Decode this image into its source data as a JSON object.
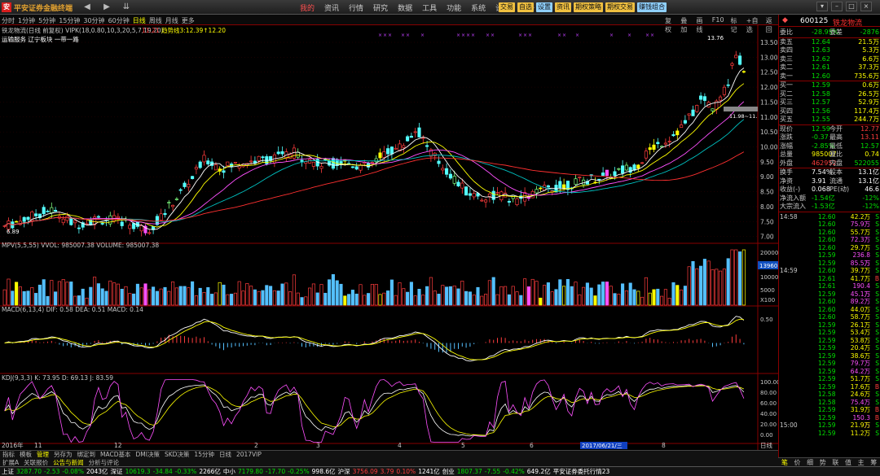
{
  "app": {
    "logo": "安",
    "title": "平安证券金融终端",
    "menu": [
      "我的",
      "资讯",
      "行情",
      "研究",
      "数据",
      "工具",
      "功能",
      "系统",
      "设置",
      "服务"
    ],
    "active_menu": 0,
    "quick_buttons": [
      {
        "label": "交易",
        "color": "#f0c040"
      },
      {
        "label": "自选",
        "color": "#f0c040"
      },
      {
        "label": "设置",
        "color": "#8fd0ff"
      },
      {
        "label": "资讯",
        "color": "#f0c040"
      },
      {
        "label": "期权策略",
        "color": "#f0c040"
      },
      {
        "label": "期权交易",
        "color": "#f0c040"
      },
      {
        "label": "赚钱组合",
        "color": "#8fd0ff"
      }
    ],
    "window_buttons": [
      "▾",
      "–",
      "□",
      "×"
    ]
  },
  "periods": [
    "分时",
    "1分钟",
    "5分钟",
    "15分钟",
    "30分钟",
    "60分钟",
    "日线",
    "周线",
    "月线",
    "更多"
  ],
  "active_period": 6,
  "right_tools": [
    "复权",
    "叠加",
    "画线",
    "F10",
    "标记",
    "+自选",
    "返回"
  ],
  "chart": {
    "header": "铁龙物流(日线 前复权) VIPK(18,0.80,10,3,20,5,7,19,20)",
    "header_time": "11:21",
    "trend_label": "趋势线3:12.39↑12.20",
    "sector": "运输服务 辽宁板块 一带一路",
    "price_high_label": "13.76",
    "price_low_label": "6.89",
    "ref_label": "11.98~11.",
    "price_axis": [
      "13.50",
      "13.00",
      "12.50",
      "12.00",
      "11.50",
      "11.00",
      "10.50",
      "10.00",
      "9.50",
      "9.00",
      "8.50",
      "8.00",
      "7.50",
      "7.00"
    ],
    "vol_header": "MPV(5,5,55) VVOL: 985007.38  VOLUME: 985007.38",
    "vol_axis": [
      "20000",
      "10000",
      "5000",
      "X100"
    ],
    "vol_marker": "13960",
    "macd_header": "MACD(6,13,4) DIF: 0.58 DEA: 0.51 MACD: 0.14",
    "macd_axis": [
      "0.50"
    ],
    "kdj_header": "KDJ(9,3,3) K: 73.95 D: 69.13 J: 83.59",
    "kdj_axis": [
      "100.00",
      "80.00",
      "60.00",
      "40.00",
      "20.00",
      "0.00"
    ],
    "x_axis": [
      "2016年",
      "11",
      "12",
      "2",
      "3",
      "4",
      "5",
      "6",
      "7",
      "8"
    ],
    "date_cursor": "2017/06/21/三",
    "x_axis_right": "日线"
  },
  "bottom_tabs": [
    "指标",
    "模板",
    "管理",
    "另存为",
    "绑定到",
    "MACD基本",
    "DMI决策",
    "SKD决策",
    "15分钟",
    "日线",
    "2017VIP"
  ],
  "bottom_tabs_active": 2,
  "bottom_tabs2": [
    "扩展A",
    "关联报价",
    "公告与新闻",
    "分析与评论"
  ],
  "bottom_tabs2_active": 2,
  "status": [
    {
      "text": "上证",
      "cls": "white"
    },
    {
      "text": "3287.70",
      "cls": "green"
    },
    {
      "text": "-2.53",
      "cls": "green"
    },
    {
      "text": "-0.08%",
      "cls": "green"
    },
    {
      "text": "2043亿",
      "cls": "white"
    },
    {
      "text": "深证",
      "cls": "white"
    },
    {
      "text": "10619.3",
      "cls": "green"
    },
    {
      "text": "-34.84",
      "cls": "green"
    },
    {
      "text": "-0.33%",
      "cls": "green"
    },
    {
      "text": "2266亿",
      "cls": "white"
    },
    {
      "text": "中小",
      "cls": "white"
    },
    {
      "text": "7179.80",
      "cls": "green"
    },
    {
      "text": "-17.70",
      "cls": "green"
    },
    {
      "text": "-0.25%",
      "cls": "green"
    },
    {
      "text": "998.6亿",
      "cls": "white"
    },
    {
      "text": "沪深",
      "cls": "white"
    },
    {
      "text": "3756.09",
      "cls": "red"
    },
    {
      "text": "3.79",
      "cls": "red"
    },
    {
      "text": "0.10%",
      "cls": "red"
    },
    {
      "text": "1241亿",
      "cls": "white"
    },
    {
      "text": "创业",
      "cls": "white"
    },
    {
      "text": "1807.37",
      "cls": "green"
    },
    {
      "text": "-7.55",
      "cls": "green"
    },
    {
      "text": "-0.42%",
      "cls": "green"
    },
    {
      "text": "649.2亿",
      "cls": "white"
    },
    {
      "text": "平安证券委托行情23",
      "cls": "white"
    }
  ],
  "side": {
    "code": "600125",
    "name": "铁龙物流",
    "wei": [
      {
        "l": "委比",
        "v": "-28.95%",
        "l2": "委差",
        "v2": "-2876",
        "c": "green"
      }
    ],
    "sell": [
      {
        "l": "卖五",
        "p": "12.64",
        "v": "21.5万"
      },
      {
        "l": "卖四",
        "p": "12.63",
        "v": "5.3万"
      },
      {
        "l": "卖三",
        "p": "12.62",
        "v": "6.6万"
      },
      {
        "l": "卖二",
        "p": "12.61",
        "v": "37.3万"
      },
      {
        "l": "卖一",
        "p": "12.60",
        "v": "735.6万"
      }
    ],
    "buy": [
      {
        "l": "买一",
        "p": "12.59",
        "v": "0.6万"
      },
      {
        "l": "买二",
        "p": "12.58",
        "v": "26.5万"
      },
      {
        "l": "买三",
        "p": "12.57",
        "v": "52.9万"
      },
      {
        "l": "买四",
        "p": "12.56",
        "v": "117.4万"
      },
      {
        "l": "买五",
        "p": "12.55",
        "v": "244.7万"
      }
    ],
    "stats": [
      {
        "l": "现价",
        "v": "12.59",
        "vc": "green",
        "l2": "今开",
        "v2": "12.77",
        "v2c": "red"
      },
      {
        "l": "涨跌",
        "v": "-0.37",
        "vc": "green",
        "l2": "最高",
        "v2": "13.11",
        "v2c": "red"
      },
      {
        "l": "涨幅",
        "v": "-2.85%",
        "vc": "green",
        "l2": "最低",
        "v2": "12.57",
        "v2c": "green"
      },
      {
        "l": "总量",
        "v": "985007",
        "vc": "yellow",
        "l2": "量比",
        "v2": "0.74",
        "v2c": "yellow"
      },
      {
        "l": "外盘",
        "v": "462952",
        "vc": "red",
        "l2": "内盘",
        "v2": "522055",
        "v2c": "green"
      }
    ],
    "stats2": [
      {
        "l": "换手",
        "v": "7.54%",
        "vc": "white",
        "l2": "股本",
        "v2": "13.1亿",
        "v2c": "white"
      },
      {
        "l": "净资",
        "v": "3.91",
        "vc": "white",
        "l2": "流通",
        "v2": "13.1亿",
        "v2c": "white"
      },
      {
        "l": "收益(-)",
        "v": "0.068",
        "vc": "white",
        "l2": "PE(动)",
        "v2": "46.6",
        "v2c": "white"
      },
      {
        "l": "净流入额",
        "v": "-1.54亿",
        "vc": "green",
        "l2": "",
        "v2": "-12%",
        "v2c": "green"
      },
      {
        "l": "大宗流入",
        "v": "-1.53亿",
        "vc": "green",
        "l2": "",
        "v2": "-12%",
        "v2c": "green"
      }
    ],
    "ticks": [
      {
        "t": "14:58",
        "p": "12.60",
        "pc": "green",
        "v": "42.2万",
        "vc": "yellow",
        "s": "S",
        "sc": "green"
      },
      {
        "t": "",
        "p": "12.60",
        "pc": "green",
        "v": "75.9万",
        "vc": "magenta",
        "s": "S",
        "sc": "green"
      },
      {
        "t": "",
        "p": "12.60",
        "pc": "green",
        "v": "55.7万",
        "vc": "yellow",
        "s": "S",
        "sc": "green"
      },
      {
        "t": "",
        "p": "12.60",
        "pc": "green",
        "v": "72.3万",
        "vc": "magenta",
        "s": "S",
        "sc": "green"
      },
      {
        "t": "",
        "p": "12.60",
        "pc": "green",
        "v": "29.7万",
        "vc": "yellow",
        "s": "S",
        "sc": "green"
      },
      {
        "t": "",
        "p": "12.59",
        "pc": "green",
        "v": "236.8万",
        "vc": "magenta",
        "s": "S",
        "sc": "green"
      },
      {
        "t": "",
        "p": "12.59",
        "pc": "green",
        "v": "85.5万",
        "vc": "magenta",
        "s": "S",
        "sc": "green"
      },
      {
        "t": "14:59",
        "p": "12.60",
        "pc": "green",
        "v": "39.7万",
        "vc": "yellow",
        "s": "S",
        "sc": "green"
      },
      {
        "t": "",
        "p": "12.61",
        "pc": "green",
        "v": "41.7万",
        "vc": "yellow",
        "s": "B",
        "sc": "red"
      },
      {
        "t": "",
        "p": "12.61",
        "pc": "green",
        "v": "190.4万",
        "vc": "magenta",
        "s": "S",
        "sc": "green"
      },
      {
        "t": "",
        "p": "12.59",
        "pc": "green",
        "v": "45.1万",
        "vc": "magenta",
        "s": "S",
        "sc": "green"
      },
      {
        "t": "",
        "p": "12.60",
        "pc": "green",
        "v": "89.2万",
        "vc": "magenta",
        "s": "S",
        "sc": "green"
      },
      {
        "t": "",
        "p": "12.60",
        "pc": "green",
        "v": "44.0万",
        "vc": "yellow",
        "s": "S",
        "sc": "green"
      },
      {
        "t": "",
        "p": "12.60",
        "pc": "green",
        "v": "58.7万",
        "vc": "yellow",
        "s": "S",
        "sc": "green"
      },
      {
        "t": "",
        "p": "12.59",
        "pc": "green",
        "v": "26.1万",
        "vc": "yellow",
        "s": "S",
        "sc": "green"
      },
      {
        "t": "",
        "p": "12.59",
        "pc": "green",
        "v": "53.4万",
        "vc": "yellow",
        "s": "S",
        "sc": "green"
      },
      {
        "t": "",
        "p": "12.59",
        "pc": "green",
        "v": "53.8万",
        "vc": "yellow",
        "s": "S",
        "sc": "green"
      },
      {
        "t": "",
        "p": "12.59",
        "pc": "green",
        "v": "20.4万",
        "vc": "yellow",
        "s": "S",
        "sc": "green"
      },
      {
        "t": "",
        "p": "12.59",
        "pc": "green",
        "v": "38.6万",
        "vc": "yellow",
        "s": "S",
        "sc": "green"
      },
      {
        "t": "",
        "p": "12.59",
        "pc": "green",
        "v": "79.7万",
        "vc": "magenta",
        "s": "S",
        "sc": "green"
      },
      {
        "t": "",
        "p": "12.59",
        "pc": "green",
        "v": "64.2万",
        "vc": "magenta",
        "s": "S",
        "sc": "green"
      },
      {
        "t": "",
        "p": "12.59",
        "pc": "green",
        "v": "51.7万",
        "vc": "yellow",
        "s": "S",
        "sc": "green"
      },
      {
        "t": "",
        "p": "12.59",
        "pc": "green",
        "v": "17.6万",
        "vc": "yellow",
        "s": "B",
        "sc": "red"
      },
      {
        "t": "",
        "p": "12.58",
        "pc": "green",
        "v": "24.6万",
        "vc": "yellow",
        "s": "S",
        "sc": "green"
      },
      {
        "t": "",
        "p": "12.58",
        "pc": "green",
        "v": "75.4万",
        "vc": "magenta",
        "s": "S",
        "sc": "green"
      },
      {
        "t": "",
        "p": "12.59",
        "pc": "green",
        "v": "31.9万",
        "vc": "yellow",
        "s": "B",
        "sc": "red"
      },
      {
        "t": "",
        "p": "12.59",
        "pc": "green",
        "v": "150.3万",
        "vc": "magenta",
        "s": "B",
        "sc": "red"
      },
      {
        "t": "15:00",
        "p": "12.59",
        "pc": "green",
        "v": "21.9万",
        "vc": "yellow",
        "s": "S",
        "sc": "green"
      },
      {
        "t": "",
        "p": "12.59",
        "pc": "green",
        "v": "11.2万",
        "vc": "yellow",
        "s": "S",
        "sc": "green"
      }
    ],
    "footer": [
      "笔",
      "价",
      "细",
      "势",
      "联",
      "值",
      "主",
      "筹"
    ],
    "footer_active": 0
  }
}
